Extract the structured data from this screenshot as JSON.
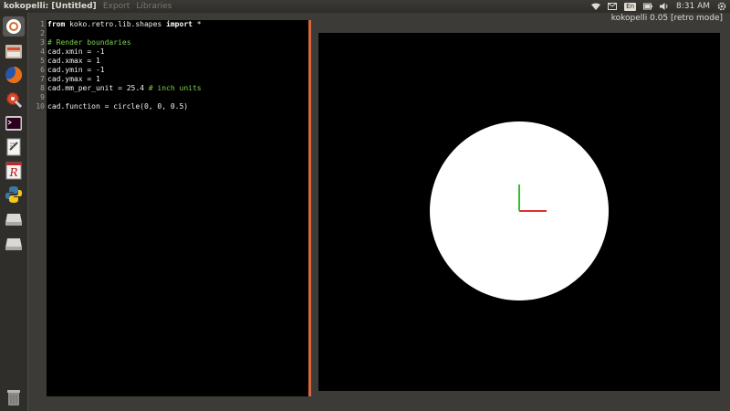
{
  "top_panel": {
    "app_name": "kokopelli:",
    "file_name": "[Untitled]",
    "menu_items": [
      "Export",
      "Libraries"
    ],
    "language": "En",
    "clock": "8:31 AM"
  },
  "window": {
    "title": "kokopelli 0.05 [retro mode]"
  },
  "launcher": {
    "items": [
      "dash-icon",
      "files-icon",
      "firefox-icon",
      "settings-icon",
      "terminal-icon",
      "text-editor-icon",
      "r-icon",
      "python-icon",
      "drive-icon",
      "drive-icon",
      "trash-icon"
    ]
  },
  "editor": {
    "line_numbers": [
      "1",
      "2",
      "3",
      "4",
      "5",
      "6",
      "7",
      "8",
      "9",
      "10"
    ],
    "lines": [
      {
        "parts": [
          {
            "t": "from",
            "c": "kw"
          },
          {
            "t": " koko.retro.lib.shapes ",
            "c": ""
          },
          {
            "t": "import",
            "c": "kw"
          },
          {
            "t": " *",
            "c": ""
          }
        ]
      },
      {
        "parts": []
      },
      {
        "parts": [
          {
            "t": "# Render boundaries",
            "c": "cm"
          }
        ]
      },
      {
        "parts": [
          {
            "t": "cad.xmin = -1",
            "c": ""
          }
        ]
      },
      {
        "parts": [
          {
            "t": "cad.xmax = 1",
            "c": ""
          }
        ]
      },
      {
        "parts": [
          {
            "t": "cad.ymin = -1",
            "c": ""
          }
        ]
      },
      {
        "parts": [
          {
            "t": "cad.ymax = 1",
            "c": ""
          }
        ]
      },
      {
        "parts": [
          {
            "t": "cad.mm_per_unit = 25.4 ",
            "c": ""
          },
          {
            "t": "# inch units",
            "c": "cm"
          }
        ]
      },
      {
        "parts": []
      },
      {
        "parts": [
          {
            "t": "cad.function = circle(0, 0, 0.5)",
            "c": ""
          }
        ]
      }
    ]
  },
  "viewer": {
    "background": "#000000",
    "shape_color": "#ffffff",
    "x_axis_color": "#e03030",
    "y_axis_color": "#30c030"
  }
}
